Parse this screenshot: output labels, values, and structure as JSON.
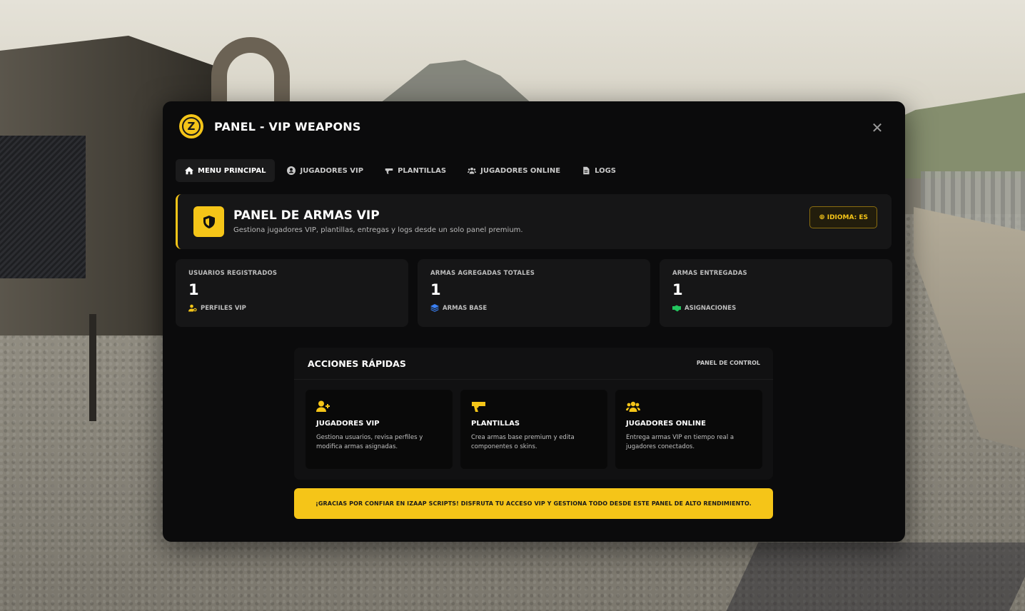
{
  "app": {
    "title": "PANEL - VIP WEAPONS",
    "logo_letter": "Z",
    "close_symbol": "✕",
    "accent_color": "#f5c518"
  },
  "tabs": [
    {
      "label": "MENU PRINCIPAL",
      "icon": "home-icon",
      "active": true
    },
    {
      "label": "JUGADORES VIP",
      "icon": "user-circle-icon",
      "active": false
    },
    {
      "label": "PLANTILLAS",
      "icon": "gun-icon",
      "active": false
    },
    {
      "label": "JUGADORES ONLINE",
      "icon": "users-icon",
      "active": false
    },
    {
      "label": "LOGS",
      "icon": "file-icon",
      "active": false
    }
  ],
  "hero": {
    "title": "PANEL DE ARMAS VIP",
    "subtitle": "Gestiona jugadores VIP, plantillas, entregas y logs desde un solo panel premium.",
    "icon": "shield-icon",
    "language_button": "IDIOMA: ES"
  },
  "stats": [
    {
      "label": "USUARIOS REGISTRADOS",
      "value": "1",
      "foot": "PERFILES VIP",
      "foot_icon": "user-key-icon",
      "foot_color": "#f5c518"
    },
    {
      "label": "ARMAS AGREGADAS TOTALES",
      "value": "1",
      "foot": "ARMAS BASE",
      "foot_icon": "layers-icon",
      "foot_color": "#3b82f6"
    },
    {
      "label": "ARMAS ENTREGADAS",
      "value": "1",
      "foot": "ASIGNACIONES",
      "foot_icon": "handshake-icon",
      "foot_color": "#22c55e"
    }
  ],
  "quick_actions": {
    "title": "ACCIONES RÁPIDAS",
    "side_label": "PANEL DE CONTROL",
    "cards": [
      {
        "title": "JUGADORES VIP",
        "desc": "Gestiona usuarios, revisa perfiles y modifica armas asignadas.",
        "icon": "user-plus-icon"
      },
      {
        "title": "PLANTILLAS",
        "desc": "Crea armas base premium y edita componentes o skins.",
        "icon": "gun-icon"
      },
      {
        "title": "JUGADORES ONLINE",
        "desc": "Entrega armas VIP en tiempo real a jugadores conectados.",
        "icon": "users-icon"
      }
    ]
  },
  "footer_message": "¡GRACIAS POR CONFIAR EN IZAAP SCRIPTS! DISFRUTA TU ACCESO VIP Y GESTIONA TODO DESDE ESTE PANEL DE ALTO RENDIMIENTO."
}
